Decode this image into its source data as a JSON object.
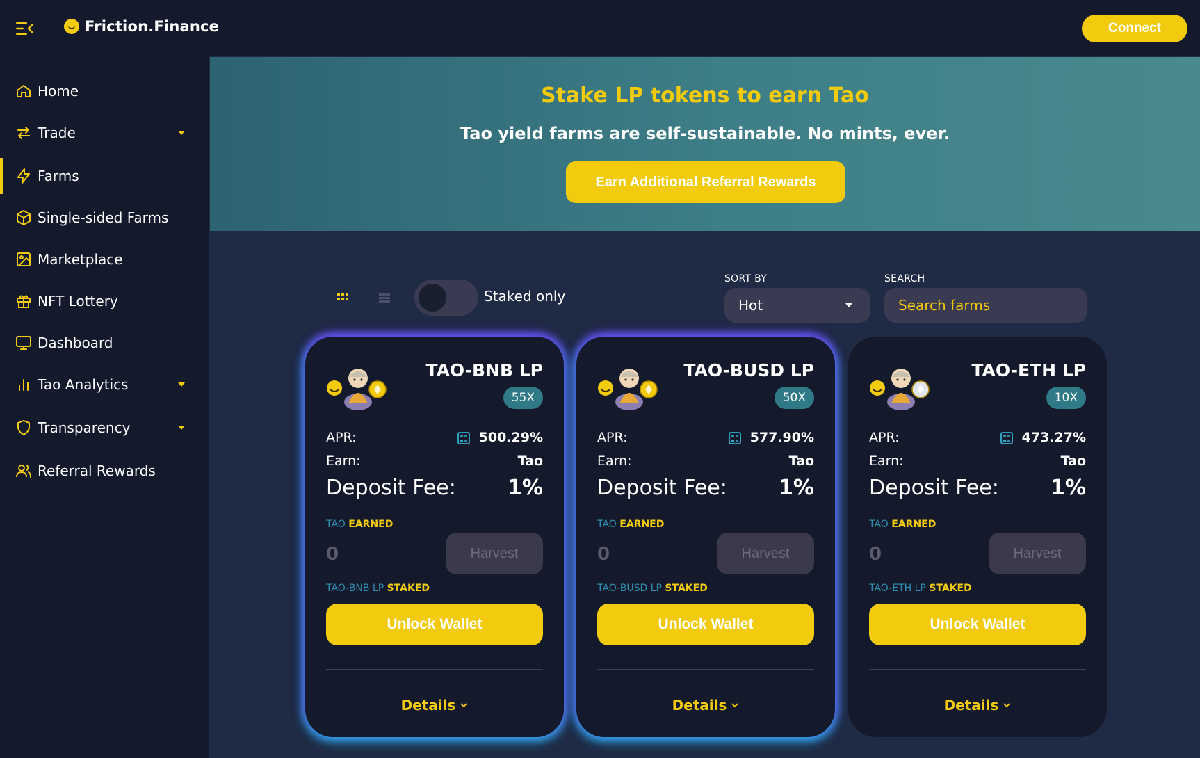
{
  "app": {
    "brand_name": "Friction.Finance"
  },
  "header": {
    "connect_label": "Connect"
  },
  "sidebar": {
    "items": [
      {
        "label": "Home",
        "icon": "home-icon",
        "has_caret": false,
        "active": false
      },
      {
        "label": "Trade",
        "icon": "swap-icon",
        "has_caret": true,
        "active": false
      },
      {
        "label": "Farms",
        "icon": "bolt-icon",
        "has_caret": false,
        "active": true
      },
      {
        "label": "Single-sided Farms",
        "icon": "cube-icon",
        "has_caret": false,
        "active": false
      },
      {
        "label": "Marketplace",
        "icon": "image-icon",
        "has_caret": false,
        "active": false
      },
      {
        "label": "NFT Lottery",
        "icon": "gift-icon",
        "has_caret": false,
        "active": false
      },
      {
        "label": "Dashboard",
        "icon": "monitor-icon",
        "has_caret": false,
        "active": false
      },
      {
        "label": "Tao Analytics",
        "icon": "bar-chart-icon",
        "has_caret": true,
        "active": false
      },
      {
        "label": "Transparency",
        "icon": "shield-icon",
        "has_caret": true,
        "active": false
      },
      {
        "label": "Referral Rewards",
        "icon": "users-icon",
        "has_caret": false,
        "active": false
      }
    ]
  },
  "hero": {
    "title": "Stake LP tokens to earn Tao",
    "subtitle": "Tao yield farms are self-sustainable. No mints, ever.",
    "cta_label": "Earn Additional Referral Rewards"
  },
  "controls": {
    "staked_only_label": "Staked only",
    "staked_only_on": false,
    "sort_label": "SORT BY",
    "sort_value": "Hot",
    "search_label": "SEARCH",
    "search_placeholder": "Search farms",
    "view_mode": "grid"
  },
  "farms": [
    {
      "name": "TAO-BNB LP",
      "multiplier": "55X",
      "apr_label": "APR:",
      "apr": "500.29%",
      "earn_label": "Earn:",
      "earn": "Tao",
      "fee_label": "Deposit Fee:",
      "fee": "1%",
      "earned_token": "TAO",
      "earned_word": "EARNED",
      "earned_value": "0",
      "harvest_label": "Harvest",
      "staked_token": "TAO-BNB LP",
      "staked_word": "STAKED",
      "unlock_label": "Unlock Wallet",
      "details_label": "Details",
      "pair_token_color": "#f2cb0e",
      "highlighted": true
    },
    {
      "name": "TAO-BUSD LP",
      "multiplier": "50X",
      "apr_label": "APR:",
      "apr": "577.90%",
      "earn_label": "Earn:",
      "earn": "Tao",
      "fee_label": "Deposit Fee:",
      "fee": "1%",
      "earned_token": "TAO",
      "earned_word": "EARNED",
      "earned_value": "0",
      "harvest_label": "Harvest",
      "staked_token": "TAO-BUSD LP",
      "staked_word": "STAKED",
      "unlock_label": "Unlock Wallet",
      "details_label": "Details",
      "pair_token_color": "#f2cb0e",
      "highlighted": true
    },
    {
      "name": "TAO-ETH LP",
      "multiplier": "10X",
      "apr_label": "APR:",
      "apr": "473.27%",
      "earn_label": "Earn:",
      "earn": "Tao",
      "fee_label": "Deposit Fee:",
      "fee": "1%",
      "earned_token": "TAO",
      "earned_word": "EARNED",
      "earned_value": "0",
      "harvest_label": "Harvest",
      "staked_token": "TAO-ETH LP",
      "staked_word": "STAKED",
      "unlock_label": "Unlock Wallet",
      "details_label": "Details",
      "pair_token_color": "#dfe3ea",
      "highlighted": false
    }
  ],
  "colors": {
    "accent": "#f2cb0e",
    "background": "#1f2a44",
    "panel": "#141a2c",
    "teal": "#2f7a86"
  }
}
